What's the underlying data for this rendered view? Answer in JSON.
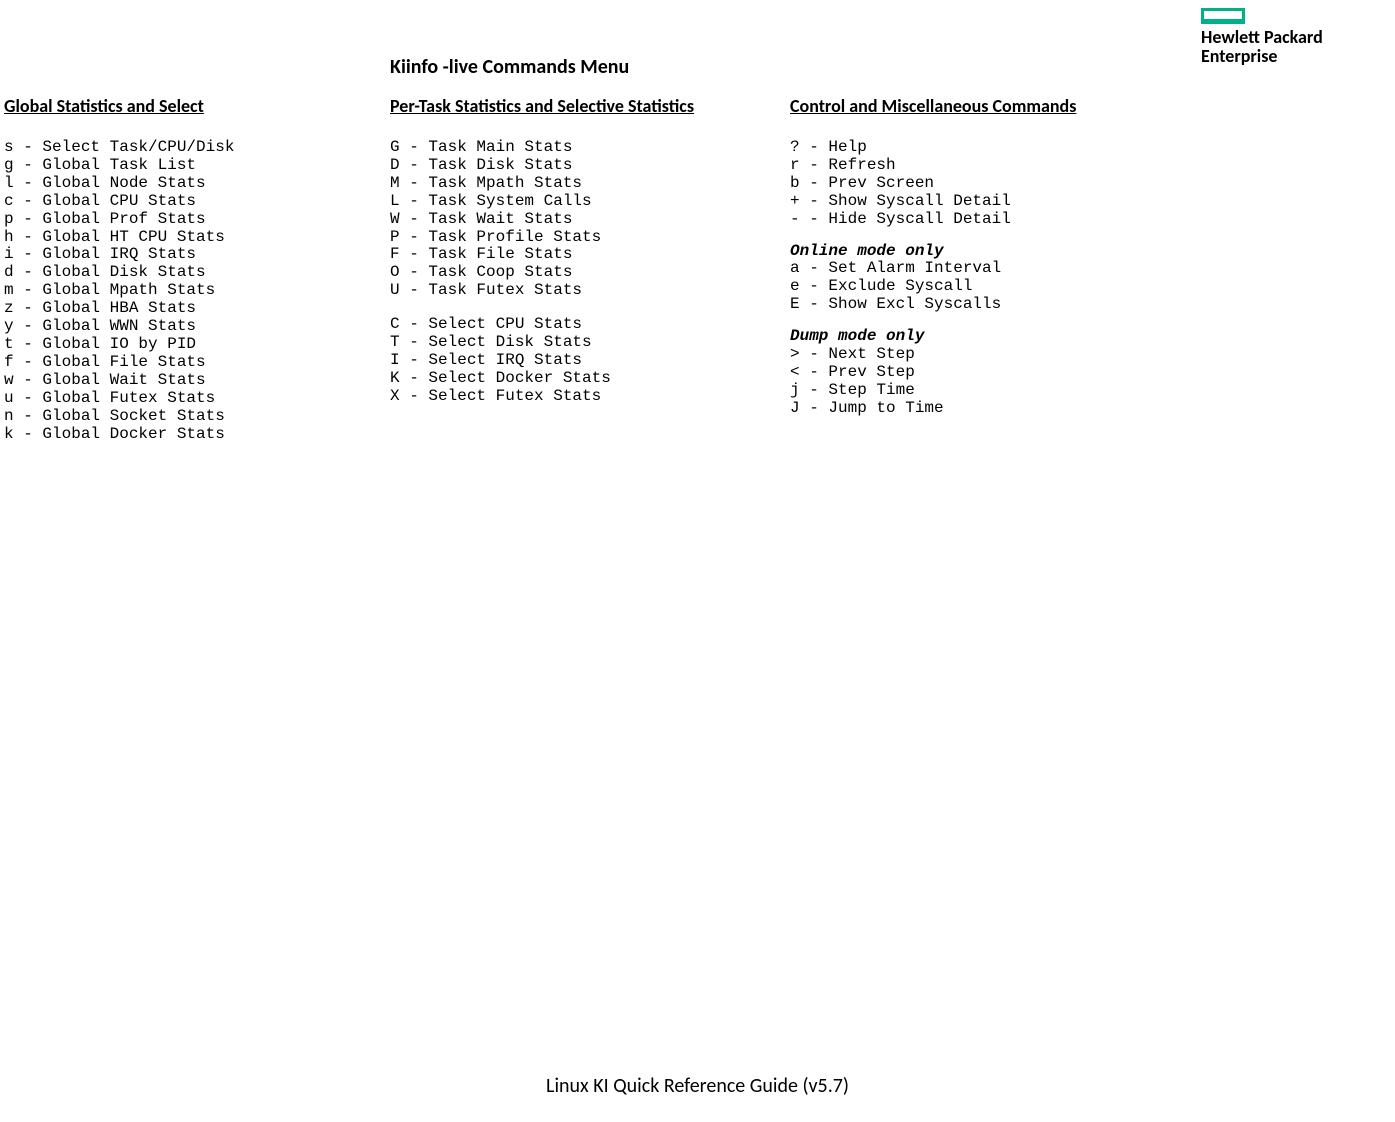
{
  "logo": {
    "line1": "Hewlett Packard",
    "line2": "Enterprise"
  },
  "mainTitle": "Kiinfo -live Commands Menu",
  "footer": "Linux KI Quick Reference Guide (v5.7)",
  "col1": {
    "heading": "Global Statistics and Select",
    "lines": [
      "s - Select Task/CPU/Disk",
      "g - Global Task List",
      "l - Global Node Stats",
      "c - Global CPU Stats",
      "p - Global Prof Stats",
      "h - Global HT CPU Stats",
      "i - Global IRQ Stats",
      "d - Global Disk Stats",
      "m - Global Mpath Stats",
      "z - Global HBA Stats",
      "y - Global WWN Stats",
      "t - Global IO by PID",
      "f - Global File Stats",
      "w - Global Wait Stats",
      "u - Global Futex Stats",
      "n - Global Socket Stats",
      "k - Global Docker Stats"
    ]
  },
  "col2": {
    "heading": "Per-Task Statistics and Selective Statistics",
    "groupA": [
      "G - Task Main Stats",
      "D - Task Disk Stats",
      "M - Task Mpath Stats",
      "L - Task System Calls",
      "W - Task Wait Stats",
      "P - Task Profile Stats",
      "F - Task File Stats",
      "O - Task Coop Stats",
      "U - Task Futex Stats"
    ],
    "groupB": [
      "C - Select CPU Stats",
      "T - Select Disk Stats",
      "I - Select IRQ Stats",
      "K - Select Docker Stats",
      "X - Select Futex Stats"
    ]
  },
  "col3": {
    "heading": "Control and Miscellaneous Commands",
    "groupA": [
      "? - Help",
      "r - Refresh",
      "b - Prev Screen",
      "+ - Show Syscall Detail",
      "- - Hide Syscall Detail"
    ],
    "subheadB": "Online mode only",
    "groupB": [
      "a - Set Alarm Interval",
      "e - Exclude Syscall",
      "E - Show Excl Syscalls"
    ],
    "subheadC": "Dump mode only",
    "groupC": [
      "> - Next Step",
      "< - Prev Step",
      "j - Step Time",
      "J - Jump to Time"
    ]
  }
}
